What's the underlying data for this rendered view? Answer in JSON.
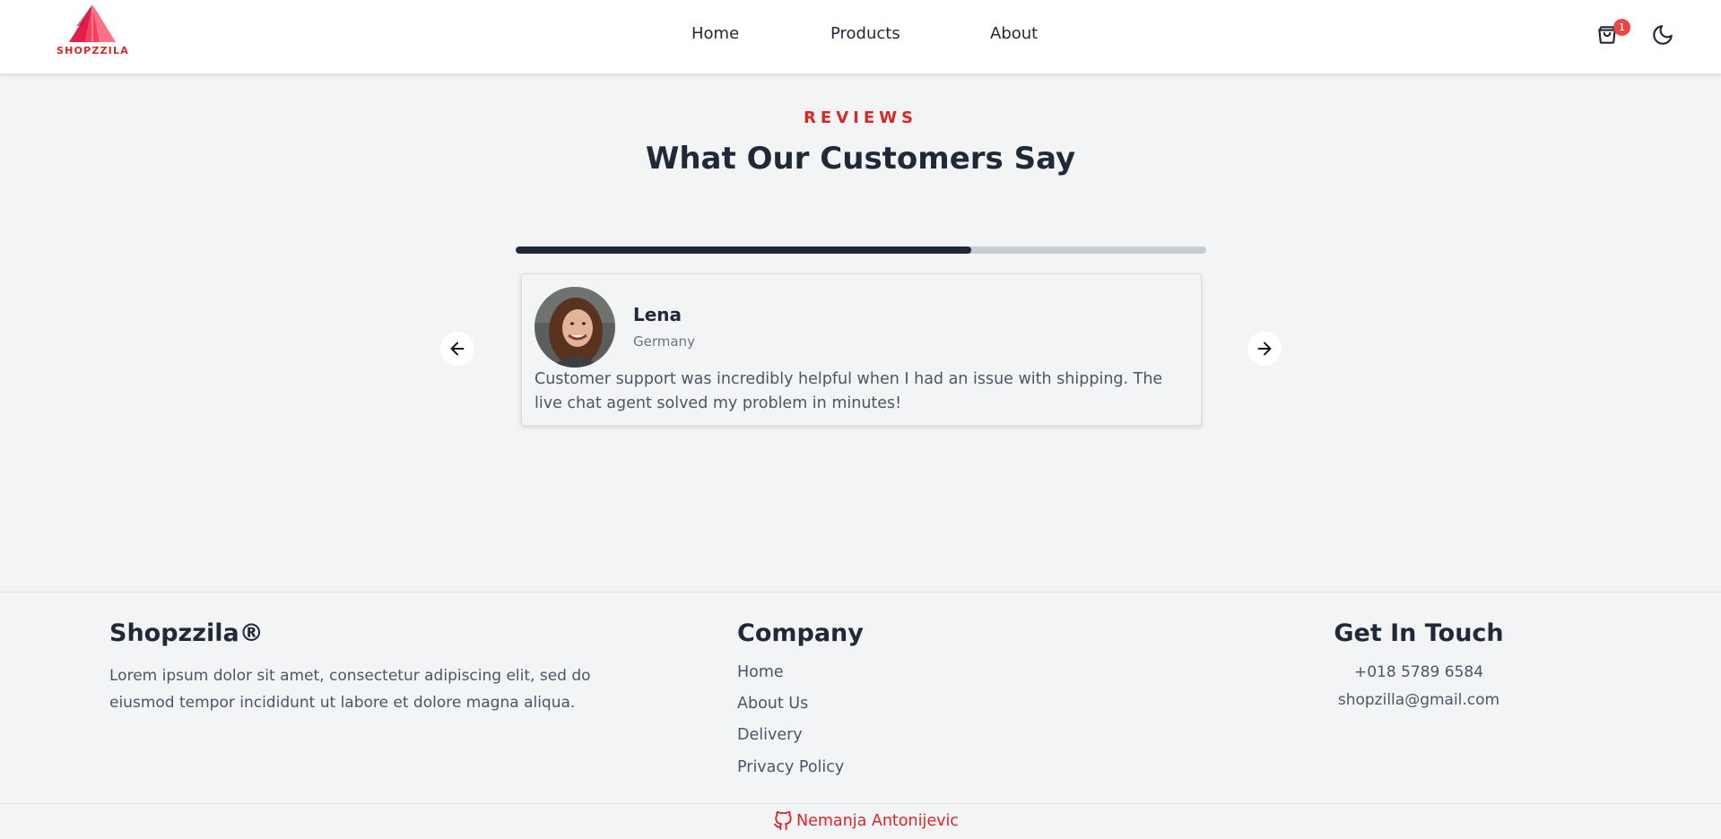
{
  "brand": {
    "logo_text": "SHOPZZILA",
    "accent": "#dc2626"
  },
  "nav": {
    "links": [
      {
        "label": "Home"
      },
      {
        "label": "Products"
      },
      {
        "label": "About"
      }
    ],
    "cart_count": "1",
    "cart_icon": "shopping-bag-icon",
    "theme_icon": "moon-icon"
  },
  "reviews": {
    "eyebrow": "REVIEWS",
    "heading": "What Our Customers Say",
    "progress_fraction": 0.66,
    "prev_icon": "arrow-left-icon",
    "next_icon": "arrow-right-icon",
    "current": {
      "name": "Lena",
      "country": "Germany",
      "text": "Customer support was incredibly helpful when I had an issue with shipping. The live chat agent solved my problem in minutes!"
    }
  },
  "footer": {
    "brand_title": "Shopzzila®",
    "description": "Lorem ipsum dolor sit amet, consectetur adipiscing elit, sed do eiusmod tempor incididunt ut labore et dolore magna aliqua.",
    "company_title": "Company",
    "company_links": [
      {
        "label": "Home"
      },
      {
        "label": "About Us"
      },
      {
        "label": "Delivery"
      },
      {
        "label": "Privacy Policy"
      }
    ],
    "contact_title": "Get In Touch",
    "phone": "+018 5789 6584",
    "email": "shopzilla@gmail.com",
    "credit": "Nemanja Antonijevic",
    "credit_icon": "github-icon"
  }
}
